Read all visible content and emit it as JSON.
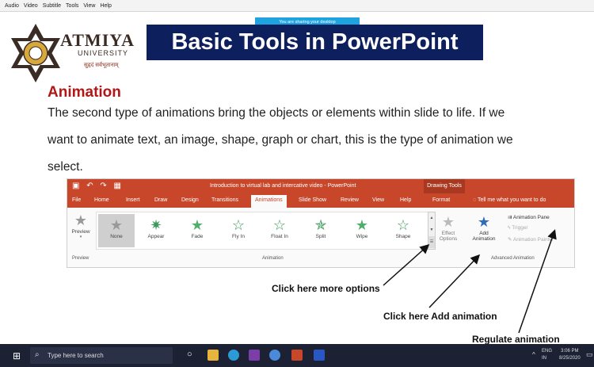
{
  "menubar": {
    "items": [
      "Audio",
      "Video",
      "Subtitle",
      "Tools",
      "View",
      "Help"
    ]
  },
  "share_banner": "You are sharing your desktop",
  "logo": {
    "name": "ATMIYA",
    "sub": "UNIVERSITY",
    "motto": "सुहृदं सर्वभूतानाम्"
  },
  "title": "Basic Tools in PowerPoint",
  "heading": "Animation",
  "paragraph": [
    "The second type of animations bring the objects or elements within slide to life. If we",
    "want to animate text, an image, shape, graph or chart, this is the type of animation we",
    "select."
  ],
  "ppt": {
    "window_title": "Introduction to virtual lab and intercative video  -  PowerPoint",
    "context_tab": "Drawing Tools",
    "tabs": [
      "File",
      "Home",
      "Insert",
      "Draw",
      "Design",
      "Transitions",
      "Animations",
      "Slide Show",
      "Review",
      "View",
      "Help",
      "Format"
    ],
    "active_tab": "Animations",
    "tell_me": "Tell me what you want to do",
    "preview_label": "Preview",
    "preview_group": "Preview",
    "animations": [
      "None",
      "Appear",
      "Fade",
      "Fly In",
      "Float In",
      "Split",
      "Wipe",
      "Shape"
    ],
    "animation_group": "Animation",
    "effect_options": "Effect Options",
    "add_animation": "Add Animation",
    "animation_pane": "Animation Pane",
    "trigger": "Trigger",
    "animation_painter": "Animation Painter",
    "advanced_group": "Advanced Animation"
  },
  "annotations": {
    "more_options": "Click here more options",
    "add_animation": "Click here Add animation",
    "regulate": "Regulate animation"
  },
  "taskbar": {
    "search_placeholder": "Type here to search",
    "lang": "ENG",
    "region": "IN",
    "time": "3:06 PM",
    "date": "8/25/2020"
  },
  "colors": {
    "ppt_accent": "#c8472a",
    "title_banner": "#0d1f5c",
    "heading": "#b01717"
  }
}
